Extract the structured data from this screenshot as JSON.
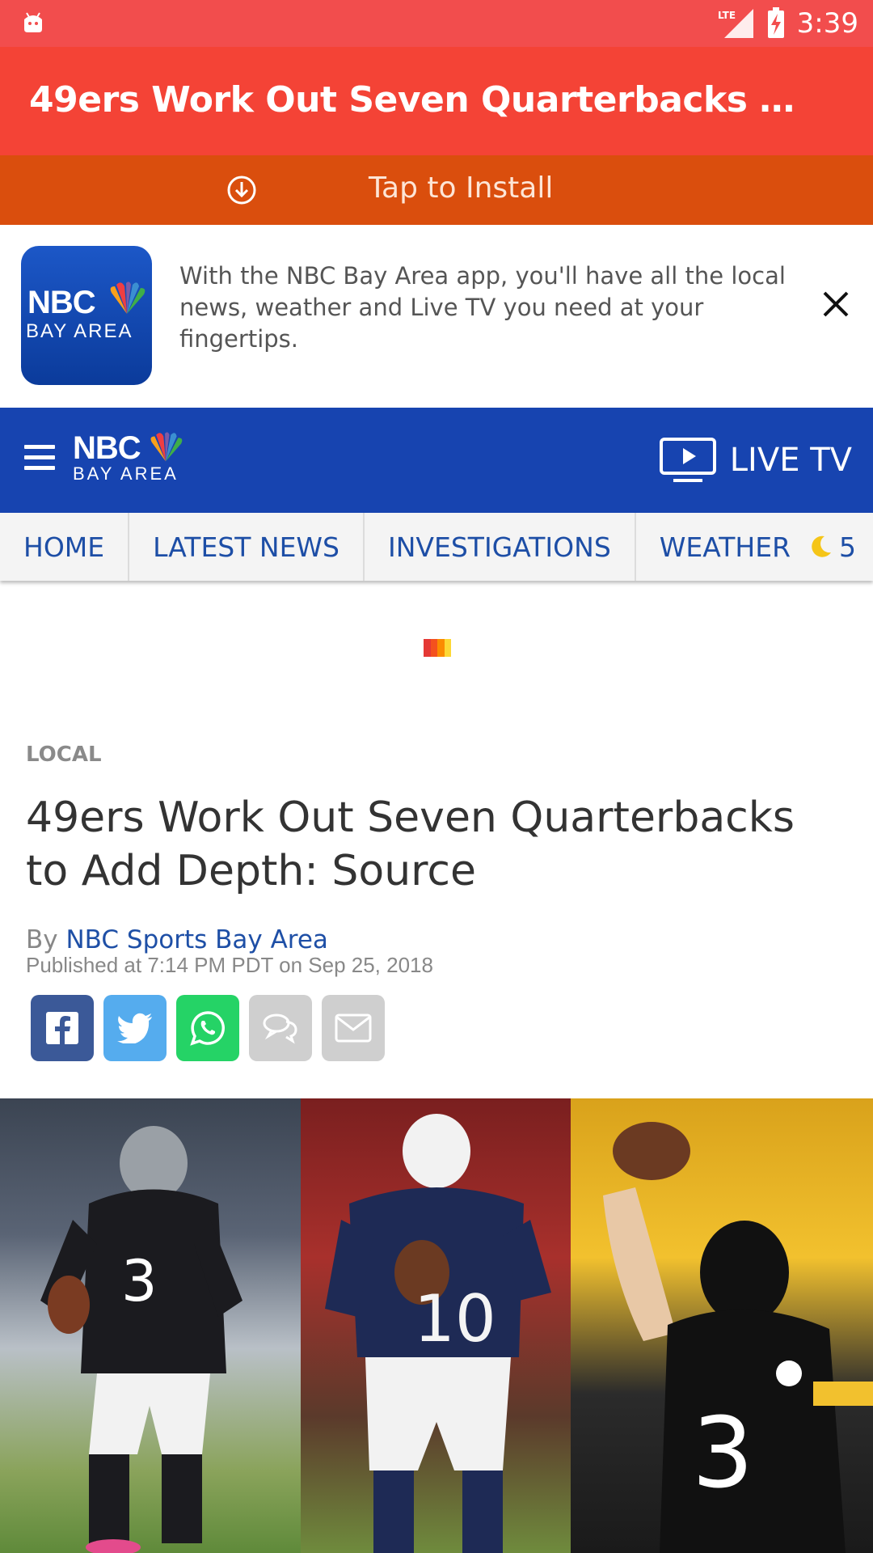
{
  "status_bar": {
    "network": "LTE",
    "time": "3:39"
  },
  "app_bar": {
    "title": "49ers Work Out Seven Quarterbacks to Add …"
  },
  "install_bar": {
    "label": "Tap to Install"
  },
  "promo": {
    "logo_text": "NBC",
    "logo_subtext": "BAY AREA",
    "message": "With the NBC Bay Area app, you'll have all the local news, weather and Live TV you need at your fingertips."
  },
  "header": {
    "brand": "NBC",
    "brand_sub": "BAY AREA",
    "live_label": "LIVE TV"
  },
  "nav": {
    "tabs": [
      {
        "label": "HOME"
      },
      {
        "label": "LATEST NEWS"
      },
      {
        "label": "INVESTIGATIONS"
      },
      {
        "label": "WEATHER"
      }
    ],
    "weather_temp": "5"
  },
  "article": {
    "section": "LOCAL",
    "headline": "49ers Work Out Seven Quarterbacks to Add Depth: Source",
    "by_prefix": "By",
    "author": "NBC Sports Bay Area",
    "published": "Published at 7:14 PM PDT on Sep 25, 2018"
  },
  "share": {
    "facebook_color": "#3b5998",
    "twitter_color": "#55acee",
    "whatsapp_color": "#25d366",
    "disabled_color": "#cfcfcf"
  },
  "colors": {
    "status_bar": "#f24d4d",
    "app_bar": "#f44336",
    "install_bar": "#da4e0d",
    "header": "#1744b0",
    "link": "#1e4fa6"
  }
}
